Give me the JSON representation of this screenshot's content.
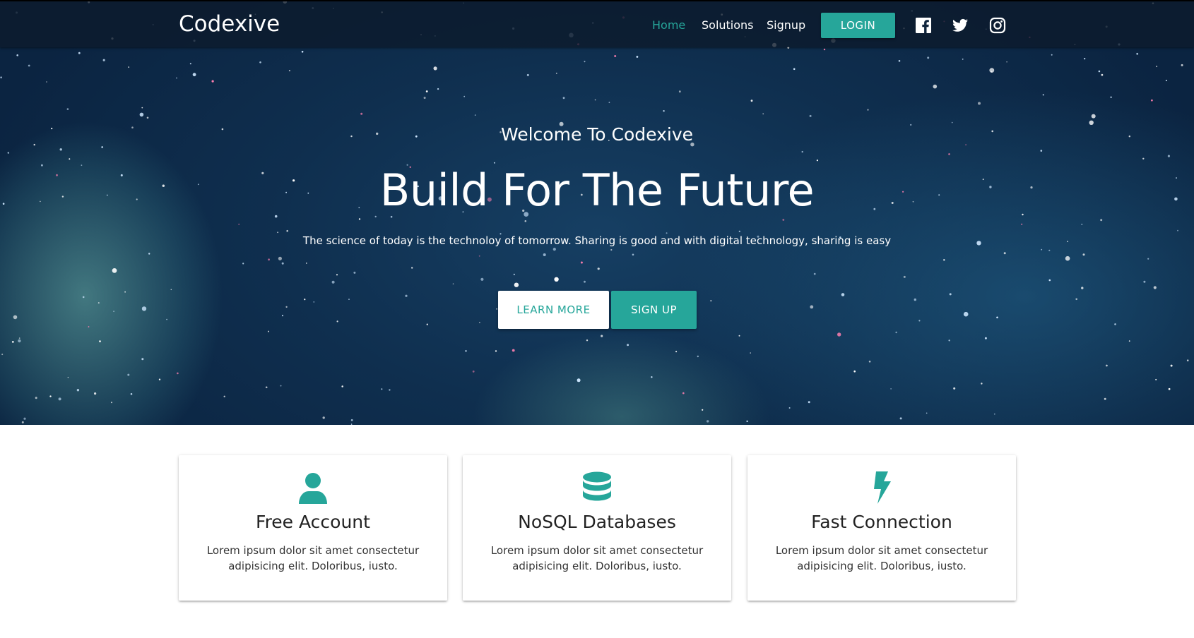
{
  "colors": {
    "accent": "#26a69a",
    "hero_bg": "#0f2f4f",
    "white": "#ffffff"
  },
  "navbar": {
    "brand": "Codexive",
    "links": [
      "Home",
      "Solutions",
      "Signup"
    ],
    "active_link": "Home",
    "login_label": "LOGIN",
    "social_icons": [
      "facebook-icon",
      "twitter-icon",
      "instagram-icon"
    ]
  },
  "hero": {
    "subtitle": "Welcome To Codexive",
    "title": "Build For The Future",
    "description": "The science of today is the technoloy of tomorrow. Sharing is good and with digital technology, sharing is easy",
    "learn_more_label": "LEARN MORE",
    "signup_label": "SIGN UP"
  },
  "features": [
    {
      "icon": "user-icon",
      "title": "Free Account",
      "text": "Lorem ipsum dolor sit amet consectetur adipisicing elit. Doloribus, iusto."
    },
    {
      "icon": "database-icon",
      "title": "NoSQL Databases",
      "text": "Lorem ipsum dolor sit amet consectetur adipisicing elit. Doloribus, iusto."
    },
    {
      "icon": "bolt-icon",
      "title": "Fast Connection",
      "text": "Lorem ipsum dolor sit amet consectetur adipisicing elit. Doloribus, iusto."
    }
  ]
}
